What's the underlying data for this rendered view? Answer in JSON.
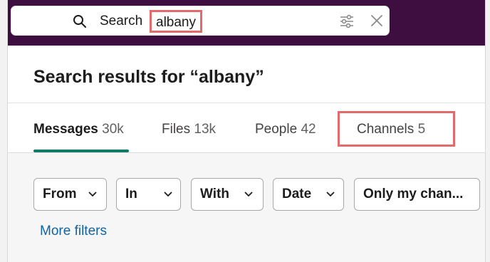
{
  "search": {
    "label": "Search",
    "query": "albany"
  },
  "results": {
    "title": "Search results for “albany”"
  },
  "tabs": [
    {
      "label": "Messages",
      "count": "30k",
      "active": true
    },
    {
      "label": "Files",
      "count": "13k",
      "active": false
    },
    {
      "label": "People",
      "count": "42",
      "active": false
    },
    {
      "label": "Channels",
      "count": "5",
      "active": false
    }
  ],
  "filters": {
    "chips": [
      "From",
      "In",
      "With",
      "Date",
      "Only my chan..."
    ],
    "more_label": "More filters"
  },
  "icons": {
    "search": "search-icon",
    "filter": "sliders-icon",
    "close": "close-icon",
    "chevron": "chevron-down-icon"
  },
  "colors": {
    "topbar": "#3f0e40",
    "highlight": "#e26a6a",
    "active_tab_underline": "#127a6b",
    "link": "#1264a3"
  }
}
